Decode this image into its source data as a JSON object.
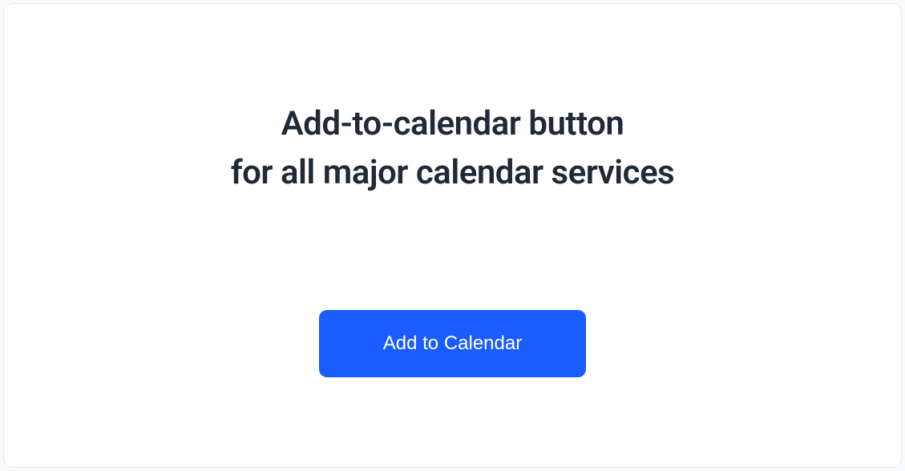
{
  "heading": {
    "line1": "Add-to-calendar button",
    "line2": "for all major calendar services"
  },
  "cta": {
    "label": "Add to Calendar"
  }
}
